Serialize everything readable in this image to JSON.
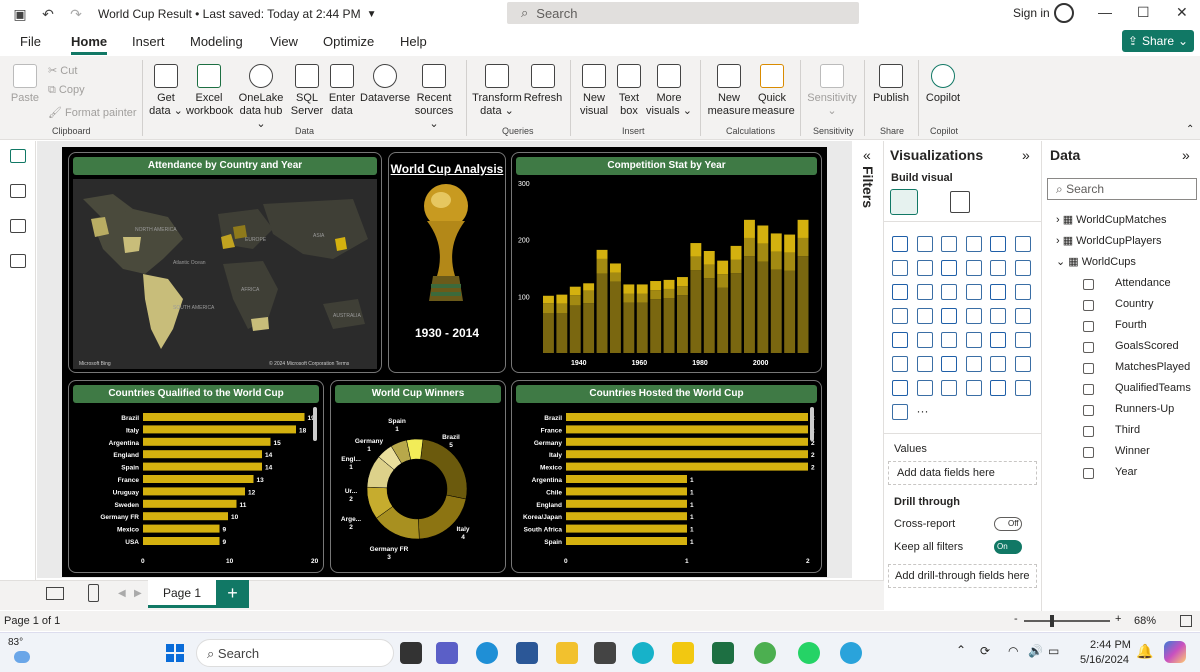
{
  "titlebar": {
    "doc_title": "World Cup Result • Last saved: Today at 2:44 PM",
    "search": "Search",
    "signin": "Sign in"
  },
  "tabs": [
    "File",
    "Home",
    "Insert",
    "Modeling",
    "View",
    "Optimize",
    "Help"
  ],
  "share": "Share",
  "ribbon": {
    "clipboard": {
      "paste": "Paste",
      "cut": "Cut",
      "copy": "Copy",
      "format_painter": "Format painter",
      "group": "Clipboard"
    },
    "data": [
      {
        "l1": "Get",
        "l2": "data ⌄"
      },
      {
        "l1": "Excel",
        "l2": "workbook"
      },
      {
        "l1": "OneLake",
        "l2": "data hub ⌄"
      },
      {
        "l1": "SQL",
        "l2": "Server"
      },
      {
        "l1": "Enter",
        "l2": "data"
      },
      {
        "l1": "Dataverse",
        "l2": ""
      },
      {
        "l1": "Recent",
        "l2": "sources ⌄"
      }
    ],
    "data_group": "Data",
    "queries": [
      {
        "l1": "Transform",
        "l2": "data ⌄"
      },
      {
        "l1": "Refresh",
        "l2": ""
      }
    ],
    "queries_group": "Queries",
    "insert": [
      {
        "l1": "New",
        "l2": "visual"
      },
      {
        "l1": "Text",
        "l2": "box"
      },
      {
        "l1": "More",
        "l2": "visuals ⌄"
      }
    ],
    "insert_group": "Insert",
    "calc": [
      {
        "l1": "New",
        "l2": "measure"
      },
      {
        "l1": "Quick",
        "l2": "measure"
      }
    ],
    "calc_group": "Calculations",
    "sensitivity": {
      "l1": "Sensitivity",
      "l2": "⌄",
      "group": "Sensitivity"
    },
    "publish": {
      "l1": "Publish",
      "group": "Share"
    },
    "copilot": {
      "l1": "Copilot",
      "group": "Copilot"
    }
  },
  "report": {
    "map_title": "Attendance by Country and Year",
    "map_labels": [
      "NORTH AMERICA",
      "EUROPE",
      "ASIA",
      "Atlantic Ocean",
      "AFRICA",
      "SOUTH AMERICA",
      "AUSTRALIA"
    ],
    "map_footer_left": "Microsoft Bing",
    "map_footer_right": "© 2024 Microsoft Corporation  Terms",
    "trophy_title": "World Cup Analysis",
    "trophy_years": "1930 - 2014",
    "comp_title": "Competition Stat by Year",
    "qual_title": "Countries Qualified to the World Cup",
    "winners_title": "World Cup Winners",
    "hosted_title": "Countries Hosted the World Cup"
  },
  "chart_data": [
    {
      "type": "bar",
      "title": "Competition Stat by Year",
      "ylim": [
        0,
        300
      ],
      "y_ticks": [
        100,
        200,
        300
      ],
      "x_ticks": [
        "1940",
        "1960",
        "1980",
        "2000"
      ],
      "categories": [
        "1930",
        "1934",
        "1938",
        "1950",
        "1954",
        "1958",
        "1962",
        "1966",
        "1970",
        "1974",
        "1978",
        "1982",
        "1986",
        "1990",
        "1994",
        "1998",
        "2002",
        "2006",
        "2010",
        "2014"
      ],
      "series": [
        {
          "values": [
            70,
            70,
            84,
            88,
            140,
            126,
            89,
            89,
            95,
            97,
            102,
            146,
            132,
            115,
            141,
            171,
            161,
            147,
            145,
            171
          ]
        },
        {
          "values": [
            18,
            17,
            18,
            22,
            26,
            16,
            16,
            16,
            16,
            16,
            16,
            24,
            24,
            24,
            24,
            32,
            32,
            32,
            32,
            32
          ]
        },
        {
          "values": [
            13,
            16,
            15,
            13,
            16,
            16,
            16,
            16,
            16,
            16,
            16,
            24,
            24,
            24,
            24,
            32,
            32,
            32,
            32,
            32
          ]
        }
      ]
    },
    {
      "type": "bar",
      "title": "Countries Qualified to the World Cup",
      "categories": [
        "Brazil",
        "Italy",
        "Argentina",
        "England",
        "Spain",
        "France",
        "Uruguay",
        "Sweden",
        "Germany FR",
        "Mexico",
        "USA"
      ],
      "values": [
        19,
        18,
        15,
        14,
        14,
        13,
        12,
        11,
        10,
        9,
        9
      ],
      "x_ticks": [
        "0",
        "10",
        "20"
      ],
      "xlim": [
        0,
        20
      ]
    },
    {
      "type": "pie",
      "title": "World Cup Winners",
      "categories": [
        "Brazil",
        "Italy",
        "Germany FR",
        "Argentina",
        "Uruguay",
        "England",
        "Germany",
        "Spain"
      ],
      "values": [
        5,
        4,
        3,
        2,
        2,
        1,
        1,
        1
      ],
      "labels": [
        "Brazil 5",
        "Italy 4",
        "Germany FR 3",
        "Arge... 2",
        "Ur... 2",
        "Engl... 1",
        "Germany 1",
        "Spain 1"
      ]
    },
    {
      "type": "bar",
      "title": "Countries Hosted the World Cup",
      "categories": [
        "Brazil",
        "France",
        "Germany",
        "Italy",
        "Mexico",
        "Argentina",
        "Chile",
        "England",
        "Korea/Japan",
        "South Africa",
        "Spain"
      ],
      "values": [
        2,
        2,
        2,
        2,
        2,
        1,
        1,
        1,
        1,
        1,
        1
      ],
      "x_ticks": [
        "0",
        "1",
        "2"
      ],
      "xlim": [
        0,
        2
      ]
    }
  ],
  "viz": {
    "title": "Visualizations",
    "build": "Build visual",
    "values": "Values",
    "add_fields": "Add data fields here",
    "drill": "Drill through",
    "cross": "Cross-report",
    "cross_state": "Off",
    "keep": "Keep all filters",
    "keep_state": "On",
    "add_drill": "Add drill-through fields here"
  },
  "filters_label": "Filters",
  "datapane": {
    "title": "Data",
    "search": "Search",
    "tables": [
      "WorldCupMatches",
      "WorldCupPlayers",
      "WorldCups"
    ],
    "fields": [
      "Attendance",
      "Country",
      "Fourth",
      "GoalsScored",
      "MatchesPlayed",
      "QualifiedTeams",
      "Runners-Up",
      "Third",
      "Winner",
      "Year"
    ]
  },
  "page_tab": "Page 1",
  "status": {
    "left": "Page 1 of 1",
    "zoom": "68%"
  },
  "taskbar": {
    "weather": "83°",
    "search": "Search",
    "time": "2:44 PM",
    "date": "5/16/2024"
  },
  "colors": {
    "accent": "#117865",
    "gold": "#d4b10f",
    "header_green": "#3f7a45"
  }
}
